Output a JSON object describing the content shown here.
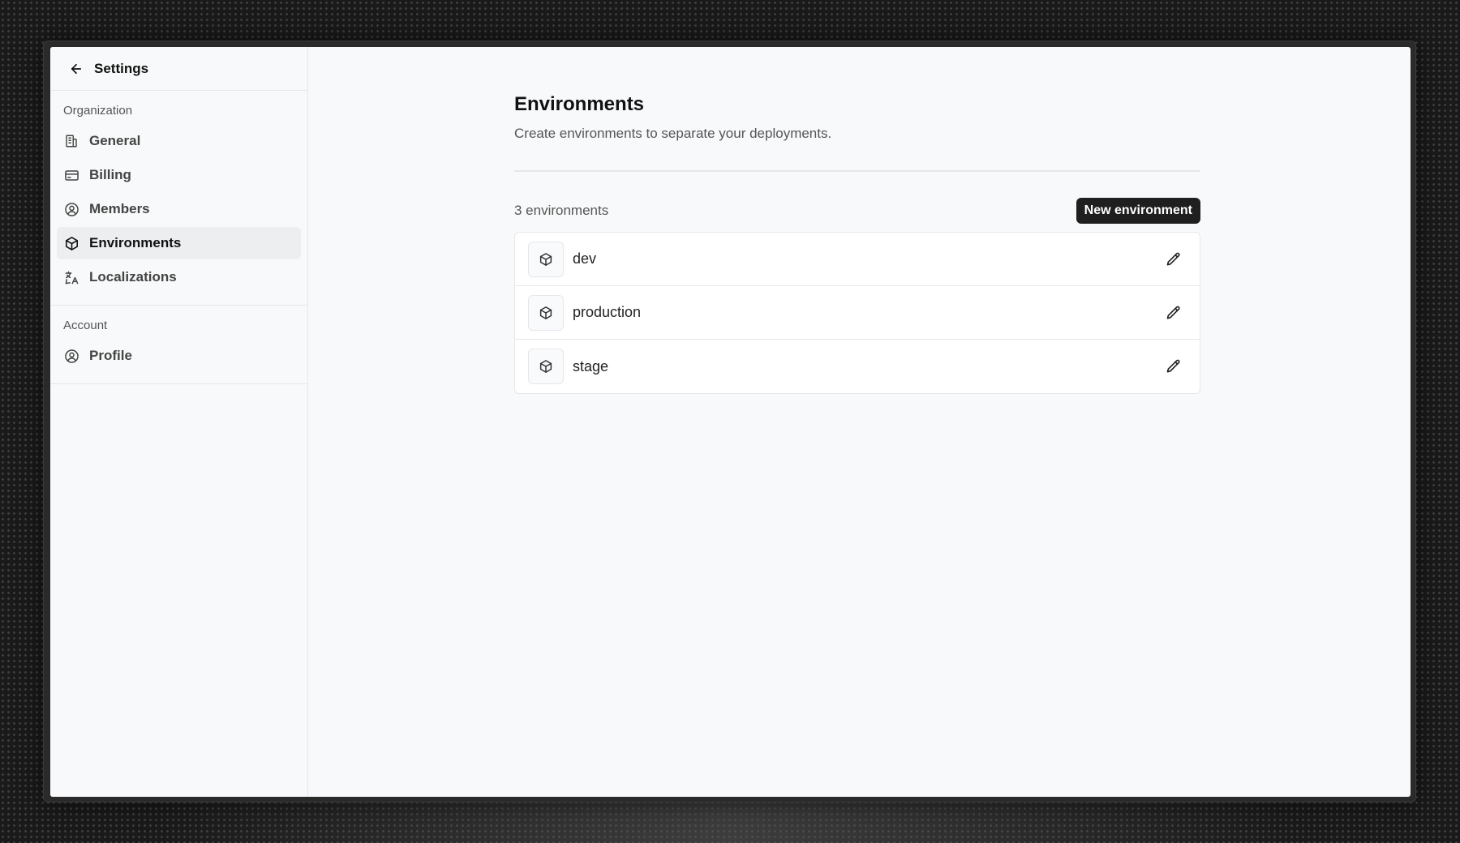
{
  "sidebar": {
    "title": "Settings",
    "sections": [
      {
        "label": "Organization",
        "items": [
          {
            "label": "General",
            "icon": "building-icon",
            "active": false
          },
          {
            "label": "Billing",
            "icon": "credit-card-icon",
            "active": false
          },
          {
            "label": "Members",
            "icon": "user-circle-icon",
            "active": false
          },
          {
            "label": "Environments",
            "icon": "cube-icon",
            "active": true
          },
          {
            "label": "Localizations",
            "icon": "languages-icon",
            "active": false
          }
        ]
      },
      {
        "label": "Account",
        "items": [
          {
            "label": "Profile",
            "icon": "user-circle-icon",
            "active": false
          }
        ]
      }
    ]
  },
  "main": {
    "title": "Environments",
    "subtitle": "Create environments to separate your deployments.",
    "count_label": "3 environments",
    "new_button_label": "New environment",
    "environments": [
      {
        "name": "dev"
      },
      {
        "name": "production"
      },
      {
        "name": "stage"
      }
    ]
  }
}
